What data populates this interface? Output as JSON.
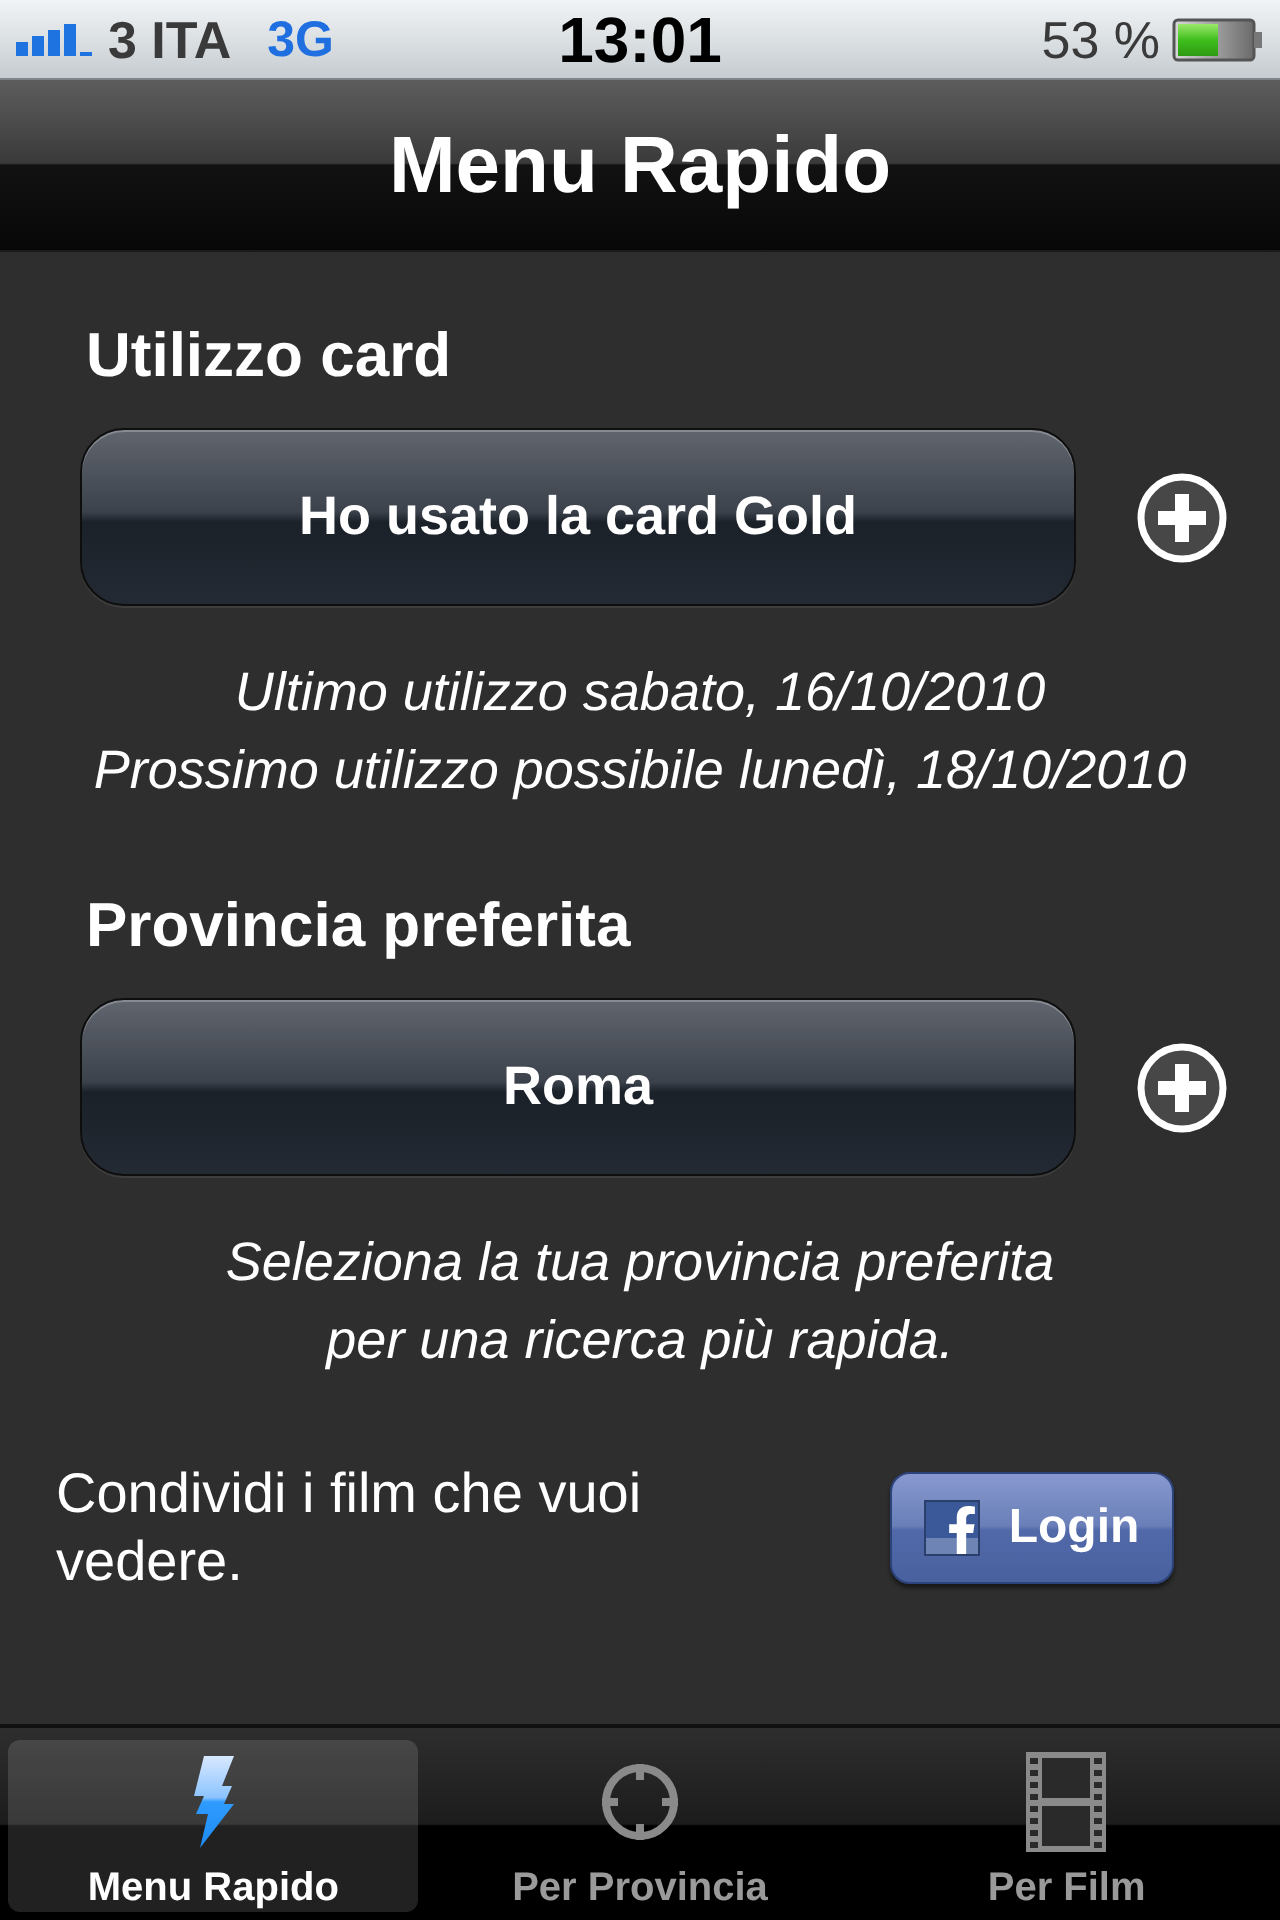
{
  "status_bar": {
    "carrier": "3 ITA",
    "network": "3G",
    "time": "13:01",
    "battery": "53 %"
  },
  "nav_bar": {
    "title": "Menu Rapido"
  },
  "sections": [
    {
      "heading": "Utilizzo card",
      "button": "Ho usato la card Gold",
      "notes": [
        {
          "lines": [
            "Ultimo utilizzo sabato, 16/10/2010"
          ]
        },
        {
          "lines": [
            "Prossimo utilizzo possibile lunedì, 18/10/2010"
          ]
        }
      ]
    },
    {
      "heading": "Provincia preferita",
      "button": "Roma",
      "notes": [
        {
          "lines": [
            "Seleziona la tua provincia preferita",
            "per una ricerca più rapida."
          ]
        }
      ]
    }
  ],
  "share": {
    "text": "Condividi i film che vuoi vedere.",
    "button": "Login"
  },
  "tab_bar": {
    "items": [
      {
        "label": "Menu Rapido",
        "selected": true
      },
      {
        "label": "Per Provincia",
        "selected": false
      },
      {
        "label": "Per Film",
        "selected": false
      }
    ]
  }
}
